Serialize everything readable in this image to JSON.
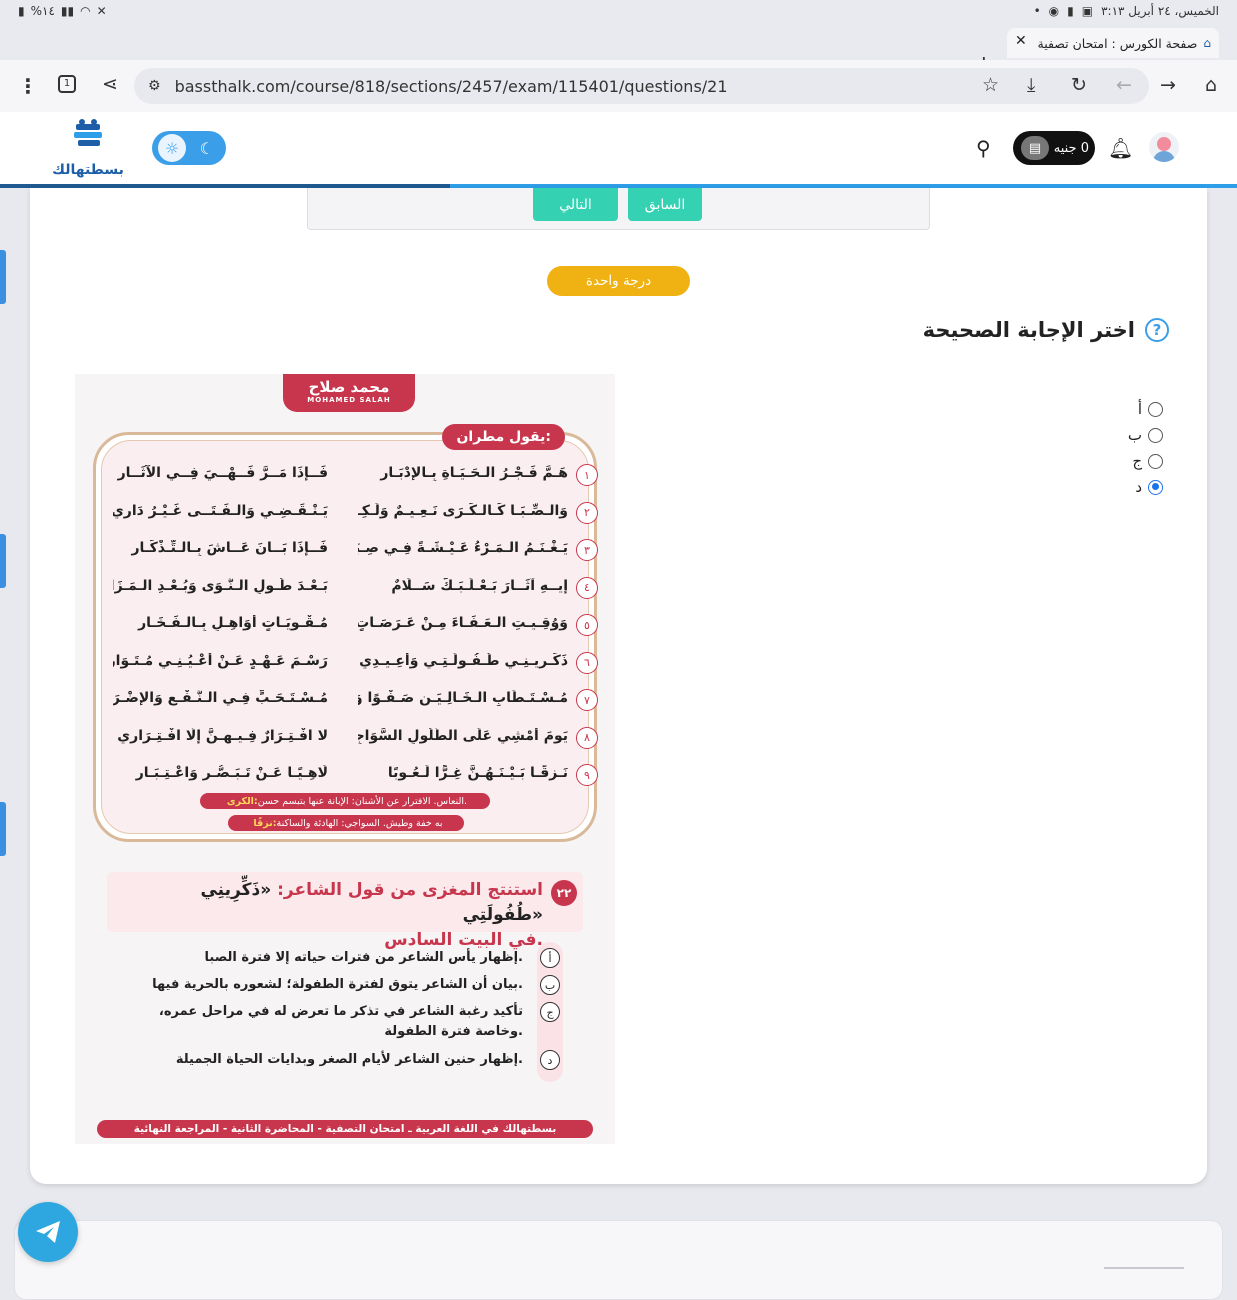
{
  "status_bar": {
    "left": "%١٤",
    "datetime": "الخميس، ٢٤ أبريل  ٣:١٣"
  },
  "browser": {
    "tab_title": "صفحة الكورس : امتحان تصفية",
    "url": "bassthalk.com/course/818/sections/2457/exam/115401/questions/21",
    "tab_count": "1"
  },
  "site_header": {
    "logo_text": "بسطتهالك",
    "wallet_label": "0 جنيه"
  },
  "nav": {
    "prev_label": "السابق",
    "next_label": "التالي"
  },
  "question": {
    "grade_badge": "درجة واحدة",
    "title": "اختر الإجابة الصحيحة",
    "options": [
      {
        "label": "أ",
        "selected": false
      },
      {
        "label": "ب",
        "selected": false
      },
      {
        "label": "ج",
        "selected": false
      },
      {
        "label": "د",
        "selected": true
      }
    ]
  },
  "question_image": {
    "brand": "محمد صلاح",
    "brand_en": "MOHAMED SALAH",
    "speaker": "يقول مطران:",
    "verses": [
      {
        "num": "١",
        "first": "هَـمَّ فَـجْـرُ الـحَـيَـاةِ بِـالإِدْبَـارِ",
        "second": "فَــإِذَا مَــرَّ فَــهْــيَ فِــي الآثَــارِ"
      },
      {
        "num": "٢",
        "first": "وَالـصِّـبَـا كَـالـكَـرَى نَـعِـيـمٌ وَلَـكِـنْ",
        "second": "يَـنْـقَـضِـي وَالـفَـتَــى غَـيْـرُ دَارِي"
      },
      {
        "num": "٣",
        "first": "يَـغْـنَـمُ الـمَـرْءُ عَـيْـشَـةً فِـي صِـبَـاهُ",
        "second": "فَــإِذَا بَــانَ عَــاشَ بِـالـتِّـذْكَـارِ"
      },
      {
        "num": "٤",
        "first": "إِيــهِ آثَــارَ بَـعْـلَـبَـكَّ سَــلَامٌ",
        "second": "بَـعْـدَ طُـولِ الـنَّـوَى وَبُـعْـدِ الـمَـزَارِ"
      },
      {
        "num": "٥",
        "first": "وَوُقِـيـتِ الـعَـفَـاءَ مِـنْ عَـرَصَـاتٍ",
        "second": "مُـقْـوِيَـاتٍ أَوَاهِـلٍ بِـالـفَـخَـارِ"
      },
      {
        "num": "٦",
        "first": "ذَكِّـرِيـنِـي طُـفُـولَـتِـي وَأَعِـيـدِي",
        "second": "رَسْـمَ عَـهْـدٍ عَـنْ أَعْـيُـنِـي مُـتَـوَارِي"
      },
      {
        "num": "٧",
        "first": "مُـسْـتَـطَابِ الـخَـالِـيَـنِ صَـفْـوًا وَشَـجْـوًا",
        "second": "مُـسْـتَـحَـبٍّ فِـي الـنَّـفْـعِ وَالإِضْـرَارِ"
      },
      {
        "num": "٨",
        "first": "يَومَ أَمْشِي عَلَى الطُّلُولِ السَّوَاجِي",
        "second": "لا افْـتِـرَارٌ فِـيـهِـنَّ إِلَّا افْـتِـرَارِي"
      },
      {
        "num": "٩",
        "first": "نَـزِقًـا بَـيْـنَـهُـنَّ غِـرًّا لَـعُـوبًا",
        "second": "لَاهِـيًـا عَـنْ تَـبَـصُّـرٍ وَاعْـتِـبَـارِ"
      }
    ],
    "glossary": [
      {
        "key": "الكرى:",
        "text": "النعاس. الافترار عن الأشنان: الإبانة عنها بتبسم حسن."
      },
      {
        "key": "نزقًا:",
        "text": "به خفة وطيش. السواجي: الهادئة والساكنة"
      }
    ],
    "question_num": "٢٢",
    "question_text": "استنتج المغزى من قول الشاعر:",
    "question_quote": "«ذَكِّرِينِي طُفُولَتِي»",
    "question_tail": "في البيت السادس.",
    "answers": [
      {
        "label": "أ",
        "text": "إظهار يأس الشاعر من فترات حياته إلا فترة الصبا."
      },
      {
        "label": "ب",
        "text": "بيان أن الشاعر يتوق لفترة الطفولة؛ لشعوره بالحرية فيها."
      },
      {
        "label": "ج",
        "text": "تأكيد رغبة الشاعر في تذكر ما تعرض له في مراحل عمره، وخاصة فترة الطفولة."
      },
      {
        "label": "د",
        "text": "إظهار حنين الشاعر لأيام الصغر وبدايات الحياة الجميلة."
      }
    ],
    "footer": "بسطتهالك في اللغة العربية ـ امتحان التصفية - المحاضرة الثانية - المراجعة النهائية"
  },
  "colors": {
    "accent": "#34d1b3",
    "grade": "#f0b213",
    "brand_red": "#c8364d",
    "primary_blue": "#2e9ee8"
  }
}
